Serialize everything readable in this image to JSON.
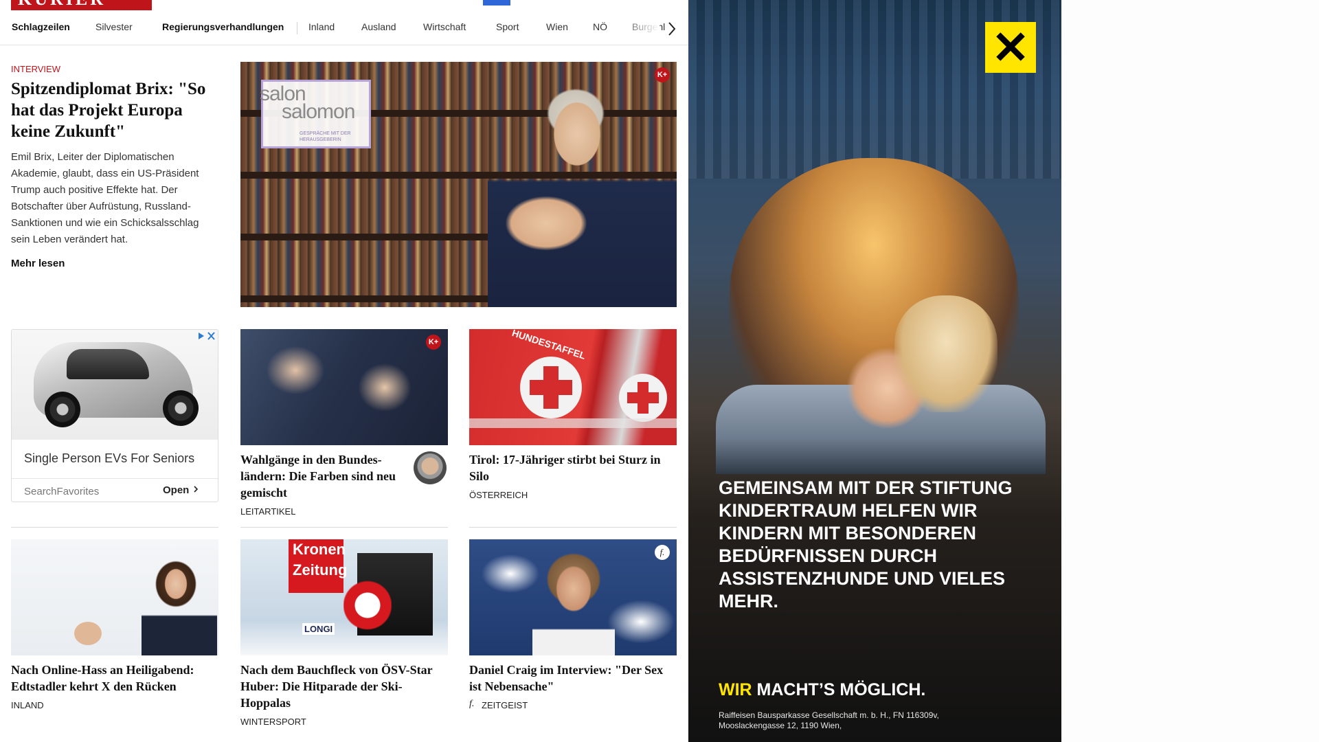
{
  "header": {
    "logo_text": "KURIER"
  },
  "nav": {
    "items": [
      {
        "label": "Schlagzeilen"
      },
      {
        "label": "Silvester"
      },
      {
        "label": "Regierungsverhandlungen"
      },
      {
        "label": "Inland"
      },
      {
        "label": "Ausland"
      },
      {
        "label": "Wirtschaft"
      },
      {
        "label": "Sport"
      },
      {
        "label": "Wien"
      },
      {
        "label": "NÖ"
      },
      {
        "label": "Burgenl"
      }
    ],
    "next_icon": "chevron-right-icon"
  },
  "hero": {
    "kicker": "INTERVIEW",
    "title": "Spitzendiplomat Brix: \"So hat das Projekt Europa keine Zukunft\"",
    "teaser": "Emil Brix, Leiter der Diplomatischen Akademie, glaubt, dass ein US-Präsident Trump auch positive Effekte hat. Der Botschafter über Aufrüstung, Russland-Sanktionen und wie ein Schicksalsschlag sein Leben verändert hat.",
    "more_label": "Mehr lesen",
    "badge": "K+",
    "salon_line1": "salon",
    "salon_line2": "salomon",
    "salon_tagline": "GESPRÄCHE MIT DER HERAUSGEBERIN"
  },
  "ad_card": {
    "headline": "Single Person EVs For Seniors",
    "advertiser": "SearchFavorites",
    "cta": "Open",
    "choices_icon": "adchoices-icon"
  },
  "articles": [
    {
      "title": "Wahlgänge in den Bundes­ländern: Die Farben sind neu gemischt",
      "rubric": "LEITARTIKEL",
      "badge": "K+"
    },
    {
      "title": "Tirol: 17-Jähriger stirbt bei Sturz in Silo",
      "rubric": "ÖSTERREICH",
      "thumb_text": "HUNDESTAFFEL"
    },
    {
      "title": "Nach Online-Hass an Heiligabend: Edtstadler kehrt X den Rücken",
      "rubric": "INLAND"
    },
    {
      "title": "Nach dem Bauchfleck von ÖSV-Star Huber: Die Hitparade der Ski-Hoppalas",
      "rubric": "WINTERSPORT",
      "thumb_text_1": "Kronen",
      "thumb_text_2": "Zeitung",
      "thumb_text_3": "LONGI"
    },
    {
      "title": "Daniel Craig im Interview: \"Der Sex ist Nebensache\"",
      "rubric": "ZEITGEIST",
      "badge": "f."
    }
  ],
  "sky_ad": {
    "claim": "Gemeinsam mit der Stiftung Kindertraum helfen wir Kindern mit besonderen Bedürfnissen durch Assistenzhunde und vieles mehr.",
    "slogan_accent": "WIR",
    "slogan_rest": " MACHT’S MÖGLICH.",
    "legal": "Raiffeisen Bausparkasse Gesellschaft m. b. H., FN 116309v, Mooslackengasse 12, 1190 Wien,",
    "logo_glyph": "✕"
  },
  "colors": {
    "brand": "#c0141b",
    "accent_blue": "#2f67d8",
    "raiffeisen_yellow": "#ffe500"
  }
}
